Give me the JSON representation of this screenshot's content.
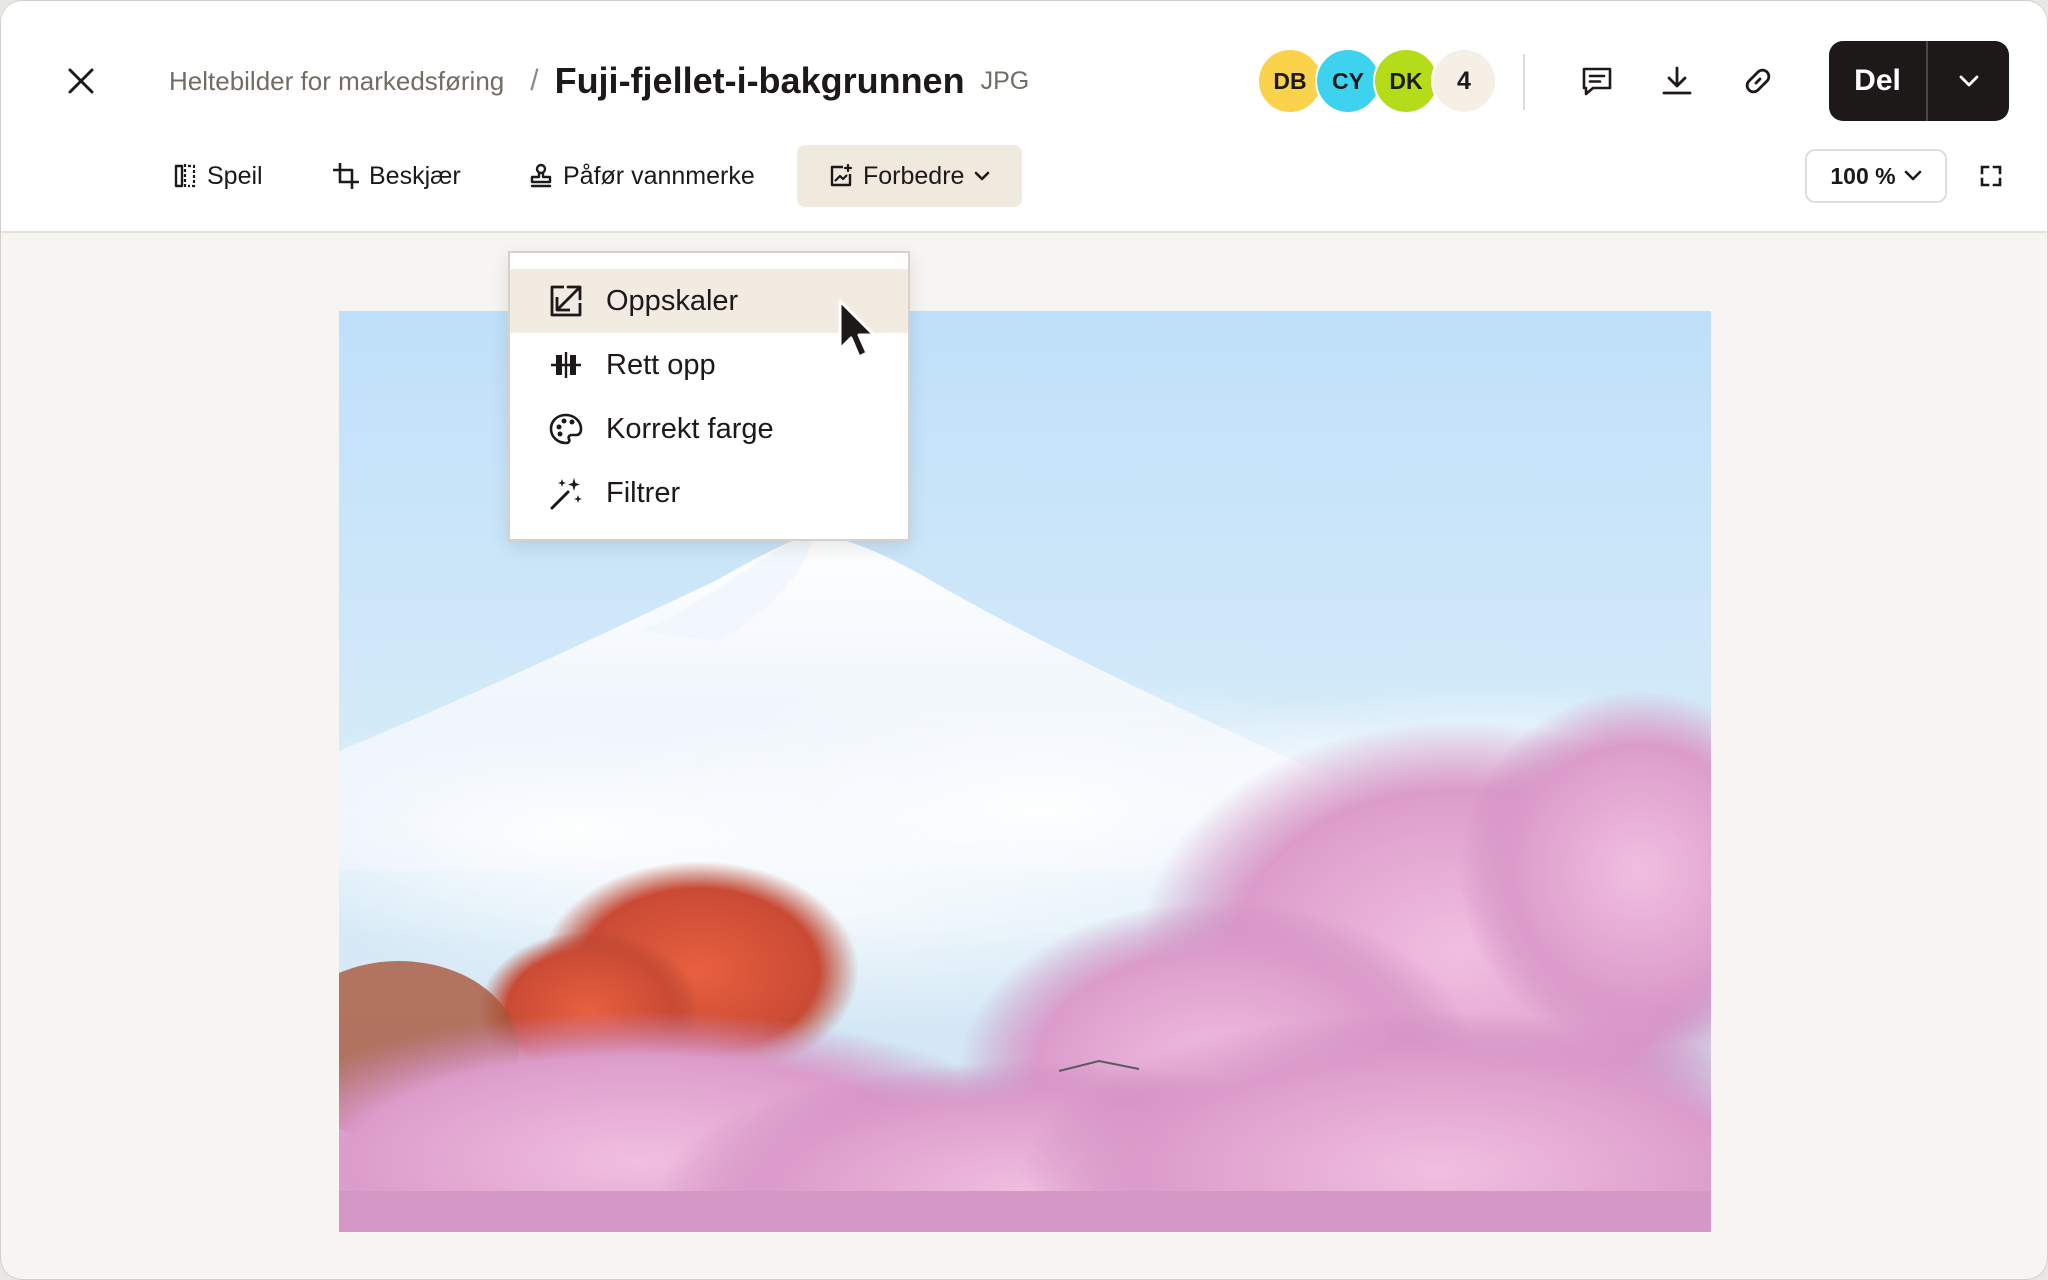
{
  "header": {
    "breadcrumb_parent": "Heltebilder for markedsføring",
    "breadcrumb_separator": "/",
    "file_title": "Fuji-fjellet-i-bakgrunnen",
    "file_type": "JPG",
    "collaborators": [
      {
        "initials": "DB",
        "color": "#fad24b"
      },
      {
        "initials": "CY",
        "color": "#3dd3ee"
      },
      {
        "initials": "DK",
        "color": "#b4dc19"
      }
    ],
    "collaborator_extra_count": "4",
    "share_label": "Del"
  },
  "toolbar": {
    "mirror_label": "Speil",
    "crop_label": "Beskjær",
    "watermark_label": "Påfør vannmerke",
    "enhance_label": "Forbedre",
    "zoom_value": "100 %"
  },
  "enhance_menu": {
    "items": [
      {
        "label": "Oppskaler",
        "icon": "upscale-icon",
        "hovered": true
      },
      {
        "label": "Rett opp",
        "icon": "straighten-icon"
      },
      {
        "label": "Korrekt farge",
        "icon": "palette-icon"
      },
      {
        "label": "Filtrer",
        "icon": "magic-wand-icon"
      }
    ]
  },
  "colors": {
    "accent_dark": "#1e1919",
    "active_tool_bg": "#f0e9dd",
    "sky": "#cfe8f8",
    "blossom": "#e6a8d2"
  }
}
